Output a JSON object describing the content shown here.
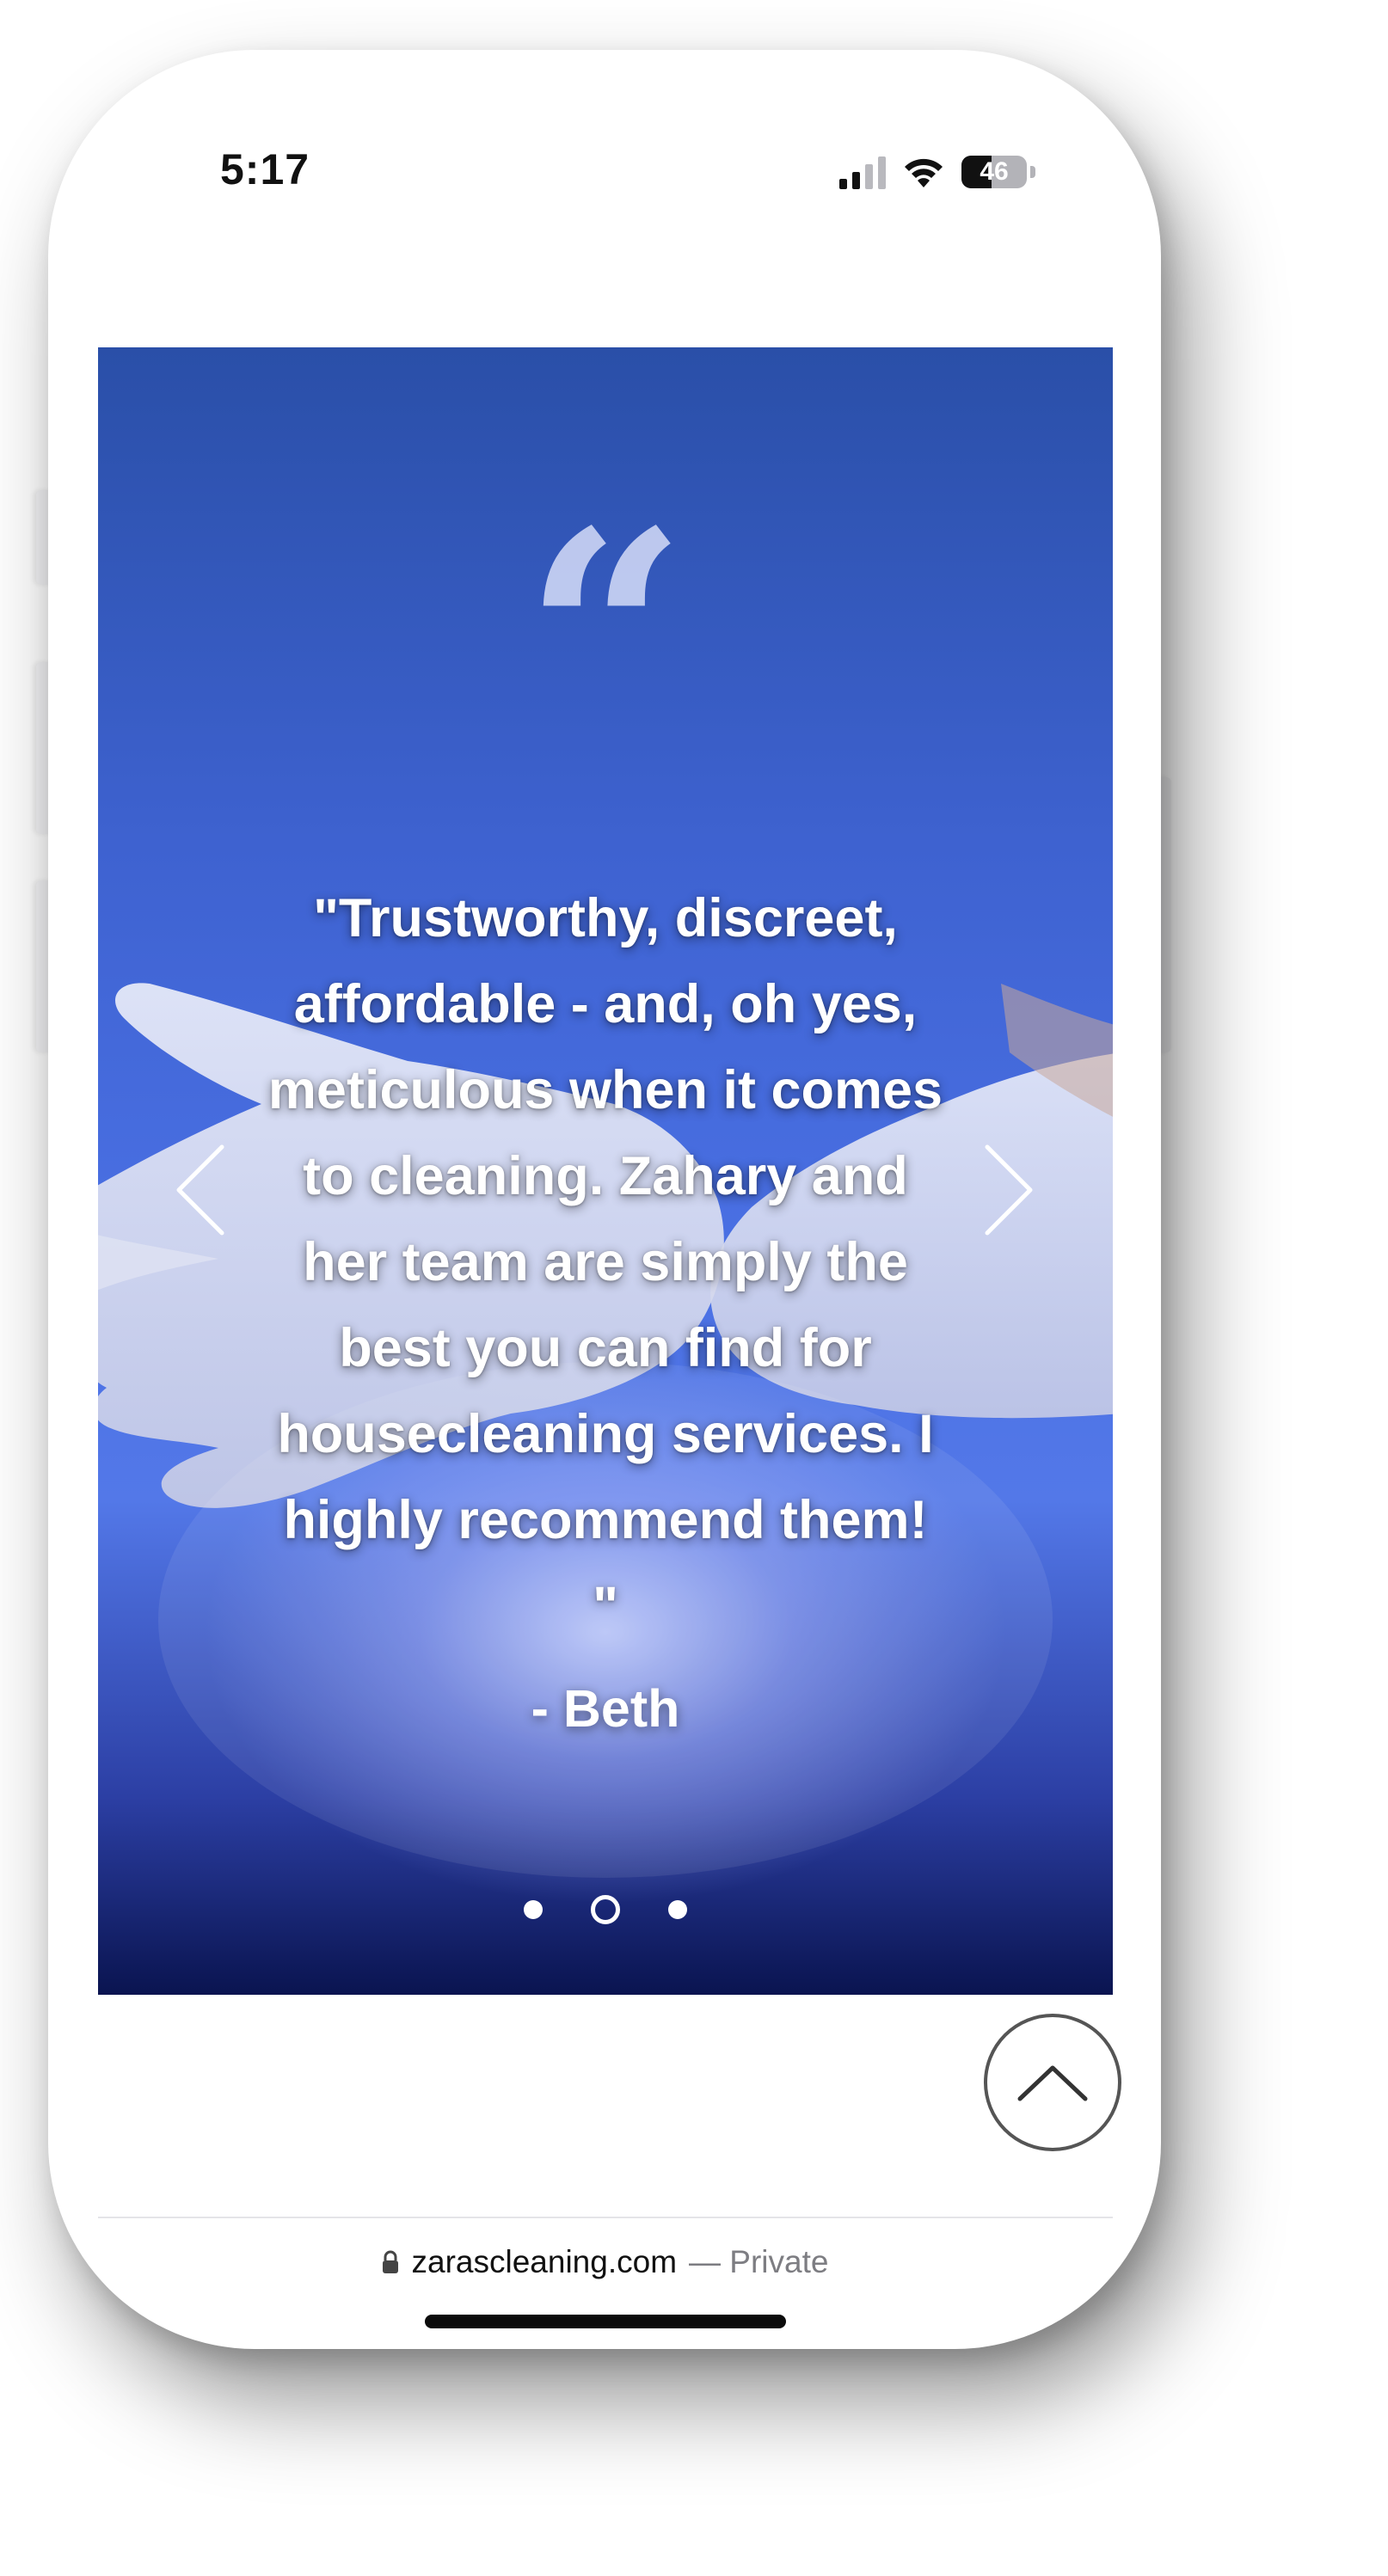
{
  "status_bar": {
    "time": "5:17",
    "battery_level": "46",
    "icons": [
      "signal-icon",
      "wifi-icon",
      "battery-icon"
    ]
  },
  "testimonial": {
    "quote_mark": "“",
    "text": "\"Trustworthy, discreet,\naffordable - and, oh yes,\nmeticulous when it comes\nto cleaning. Zahary and\nher team are simply the\nbest you can find for\nhousecleaning services. I\nhighly recommend them!\n\"",
    "author": "- Beth",
    "carousel": {
      "slide_count": 3,
      "active_index": 1,
      "prev_icon": "chevron-left-icon",
      "next_icon": "chevron-right-icon"
    },
    "colors": {
      "background_top": "#2a4fa8",
      "background_mid": "#4a70e4",
      "background_bottom": "#0a1450",
      "text": "#ffffff"
    }
  },
  "scroll_top_icon": "chevron-up-icon",
  "browser": {
    "domain": "zarascleaning.com",
    "suffix": "— Private",
    "lock_icon": "lock-icon"
  }
}
